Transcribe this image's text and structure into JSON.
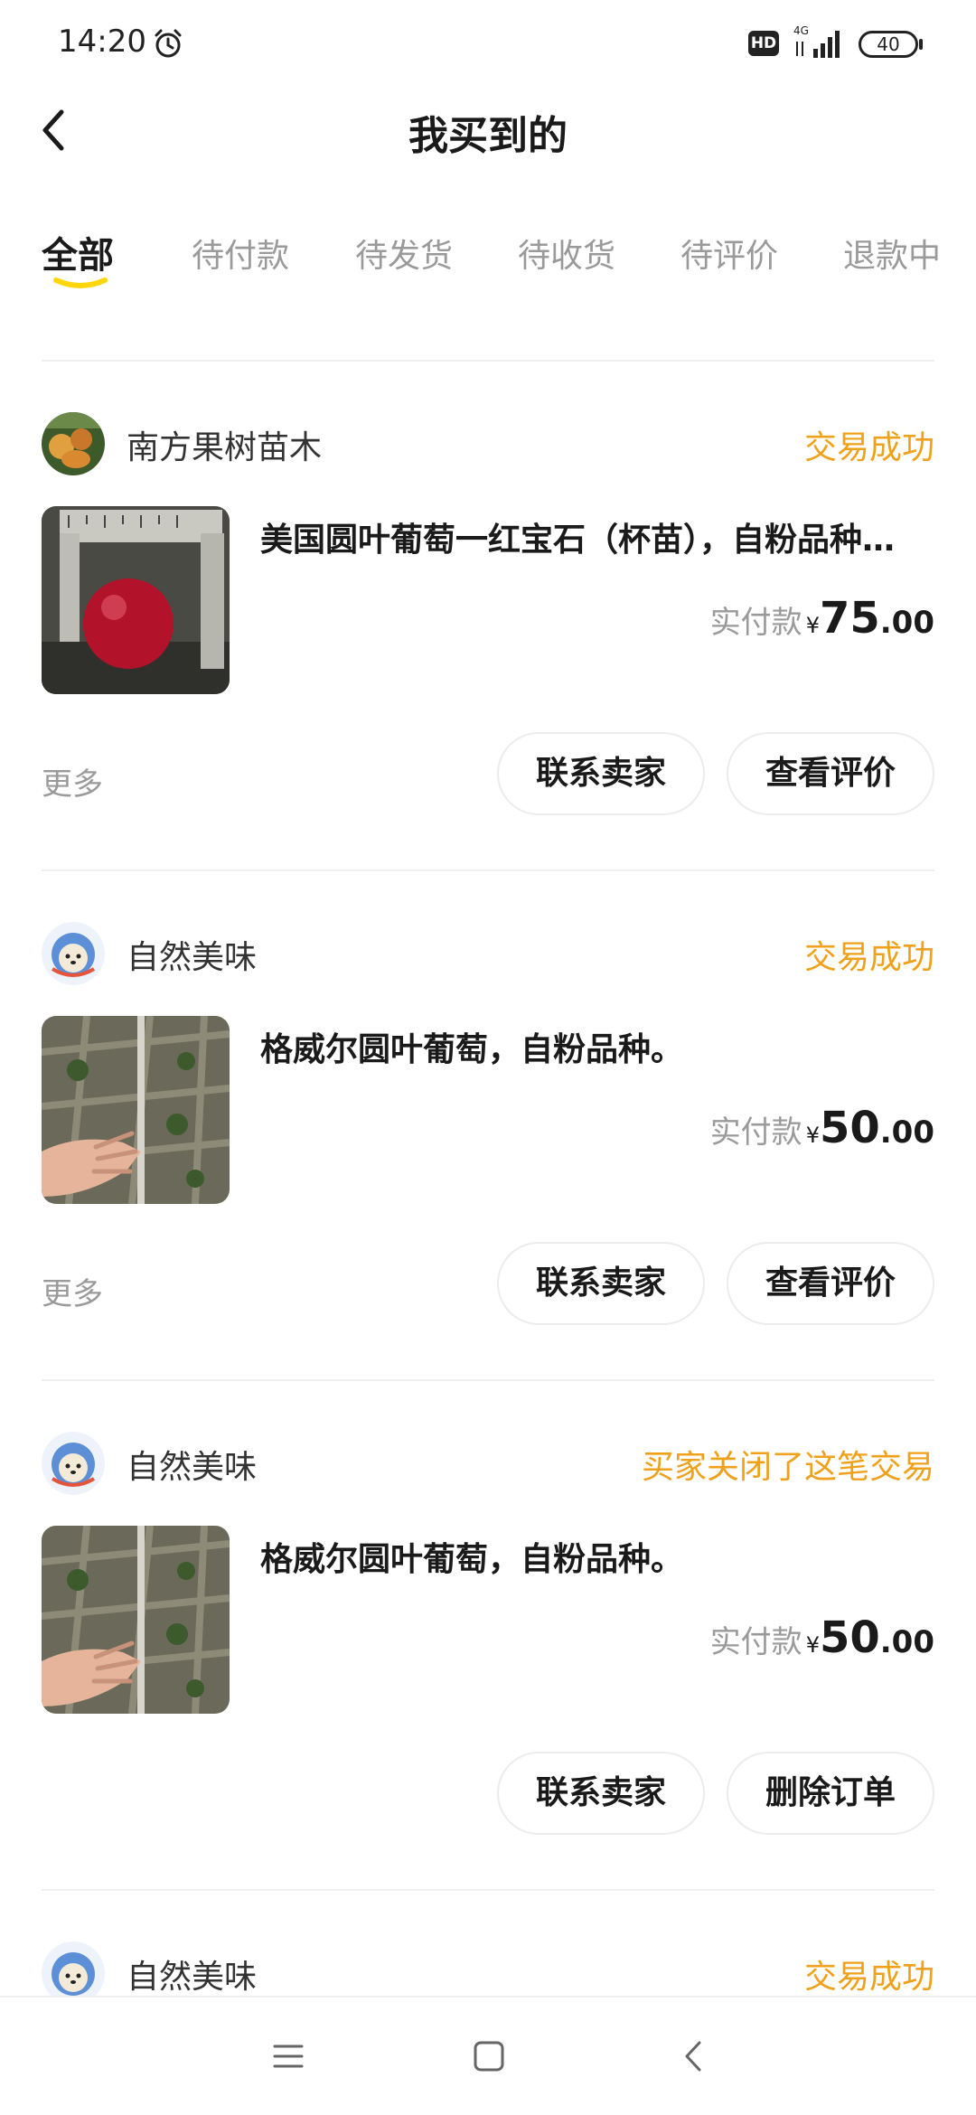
{
  "status_bar": {
    "time": "14:20",
    "hd": "HD",
    "network": "4G",
    "battery": "40"
  },
  "header": {
    "title": "我买到的"
  },
  "tabs": [
    "全部",
    "待付款",
    "待发货",
    "待收货",
    "待评价",
    "退款中"
  ],
  "orders": [
    {
      "shop": "南方果树苗木",
      "status": "交易成功",
      "title": "美国圆叶葡萄一红宝石（杯苗），自粉品种…",
      "price_label": "实付款",
      "currency": "¥",
      "price_int": "75",
      "price_dec": ".00",
      "more": "更多",
      "buttons": [
        "联系卖家",
        "查看评价"
      ]
    },
    {
      "shop": "自然美味",
      "status": "交易成功",
      "title": "格威尔圆叶葡萄，自粉品种。",
      "price_label": "实付款",
      "currency": "¥",
      "price_int": "50",
      "price_dec": ".00",
      "more": "更多",
      "buttons": [
        "联系卖家",
        "查看评价"
      ]
    },
    {
      "shop": "自然美味",
      "status": "买家关闭了这笔交易",
      "title": "格威尔圆叶葡萄，自粉品种。",
      "price_label": "实付款",
      "currency": "¥",
      "price_int": "50",
      "price_dec": ".00",
      "buttons": [
        "联系卖家",
        "删除订单"
      ]
    },
    {
      "shop": "自然美味",
      "status": "交易成功"
    }
  ],
  "colors": {
    "accent": "#f0a11b",
    "tab_underline": "#ffd60a"
  },
  "icons": {
    "back": "chevron-left-icon",
    "alarm": "alarm-clock-icon",
    "nav": [
      "menu-icon",
      "home-square-icon",
      "back-triangle-icon"
    ]
  }
}
